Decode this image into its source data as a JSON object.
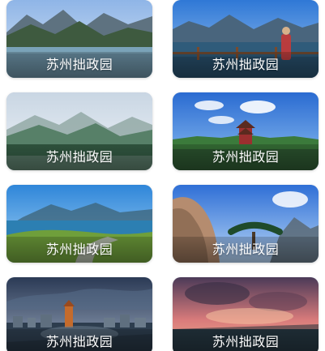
{
  "grid": {
    "cards": [
      {
        "title": "苏州拙政园",
        "scene": "mountain-lake"
      },
      {
        "title": "苏州拙政园",
        "scene": "lake-overlook-with-person"
      },
      {
        "title": "苏州拙政园",
        "scene": "misty-mountains"
      },
      {
        "title": "苏州拙政园",
        "scene": "pagoda-pavilion"
      },
      {
        "title": "苏州拙政园",
        "scene": "coastal-path"
      },
      {
        "title": "苏州拙政园",
        "scene": "cliff-pine"
      },
      {
        "title": "苏州拙政园",
        "scene": "city-tower"
      },
      {
        "title": "苏州拙政园",
        "scene": "sunset-clouds"
      }
    ]
  }
}
